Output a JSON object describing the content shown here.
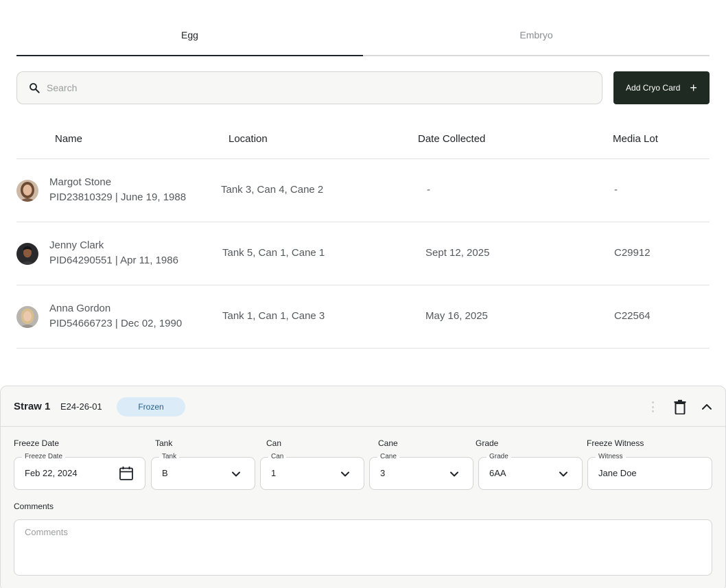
{
  "tabs": [
    {
      "label": "Egg",
      "active": true
    },
    {
      "label": "Embryo",
      "active": false
    }
  ],
  "search": {
    "placeholder": "Search"
  },
  "add_button": {
    "label": "Add Cryo Card",
    "icon": "plus-icon"
  },
  "table": {
    "headers": [
      "Name",
      "Location",
      "Date Collected",
      "Media Lot"
    ],
    "rows": [
      {
        "name": "Margot Stone",
        "pid": "PID23810329 | June 19, 1988",
        "location": "Tank 3, Can 4, Cane 2",
        "date": "-",
        "media_lot": "-"
      },
      {
        "name": "Jenny Clark",
        "pid": "PID64290551 | Apr 11, 1986",
        "location": "Tank 5, Can 1, Cane 1",
        "date": "Sept 12, 2025",
        "media_lot": "C29912"
      },
      {
        "name": "Anna Gordon",
        "pid": "PID54666723 | Dec 02, 1990",
        "location": "Tank 1, Can 1, Cane 3",
        "date": "May 16, 2025",
        "media_lot": "C22564"
      }
    ]
  },
  "straw": {
    "title": "Straw 1",
    "code": "E24-26-01",
    "status": "Frozen",
    "fields": {
      "freeze_date": {
        "label": "Freeze Date",
        "legend": "Freeze Date",
        "value": "Feb 22, 2024"
      },
      "tank": {
        "label": "Tank",
        "legend": "Tank",
        "value": "B"
      },
      "can": {
        "label": "Can",
        "legend": "Can",
        "value": "1"
      },
      "cane": {
        "label": "Cane",
        "legend": "Cane",
        "value": "3"
      },
      "grade": {
        "label": "Grade",
        "legend": "Grade",
        "value": "6AA"
      },
      "witness": {
        "label": "Freeze Witness",
        "legend": "Witness",
        "value": "Jane Doe"
      }
    },
    "comments": {
      "label": "Comments",
      "placeholder": "Comments"
    }
  },
  "colors": {
    "accent_dark": "#1e2a22",
    "badge_bg": "#dcebf8",
    "badge_text": "#1f5f8b",
    "panel_bg": "#f7f7f5"
  }
}
